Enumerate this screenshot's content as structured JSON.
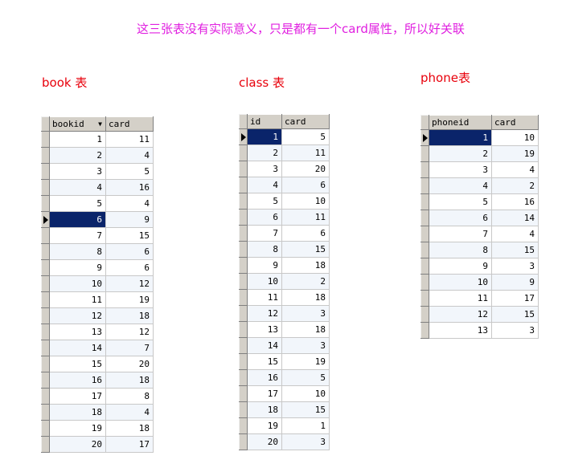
{
  "caption": "这三张表没有实际意义，只是都有一个card属性，所以好关联",
  "book": {
    "label": "book 表",
    "col1": "bookid",
    "col2": "card",
    "sort_icon": "sort-desc-icon",
    "selected_index": 5,
    "rows": [
      [
        "1",
        "11"
      ],
      [
        "2",
        "4"
      ],
      [
        "3",
        "5"
      ],
      [
        "4",
        "16"
      ],
      [
        "5",
        "4"
      ],
      [
        "6",
        "9"
      ],
      [
        "7",
        "15"
      ],
      [
        "8",
        "6"
      ],
      [
        "9",
        "6"
      ],
      [
        "10",
        "12"
      ],
      [
        "11",
        "19"
      ],
      [
        "12",
        "18"
      ],
      [
        "13",
        "12"
      ],
      [
        "14",
        "7"
      ],
      [
        "15",
        "20"
      ],
      [
        "16",
        "18"
      ],
      [
        "17",
        "8"
      ],
      [
        "18",
        "4"
      ],
      [
        "19",
        "18"
      ],
      [
        "20",
        "17"
      ]
    ]
  },
  "class": {
    "label": "class 表",
    "col1": "id",
    "col2": "card",
    "selected_index": 0,
    "rows": [
      [
        "1",
        "5"
      ],
      [
        "2",
        "11"
      ],
      [
        "3",
        "20"
      ],
      [
        "4",
        "6"
      ],
      [
        "5",
        "10"
      ],
      [
        "6",
        "11"
      ],
      [
        "7",
        "6"
      ],
      [
        "8",
        "15"
      ],
      [
        "9",
        "18"
      ],
      [
        "10",
        "2"
      ],
      [
        "11",
        "18"
      ],
      [
        "12",
        "3"
      ],
      [
        "13",
        "18"
      ],
      [
        "14",
        "3"
      ],
      [
        "15",
        "19"
      ],
      [
        "16",
        "5"
      ],
      [
        "17",
        "10"
      ],
      [
        "18",
        "15"
      ],
      [
        "19",
        "1"
      ],
      [
        "20",
        "3"
      ]
    ]
  },
  "phone": {
    "label": "phone表",
    "col1": "phoneid",
    "col2": "card",
    "selected_index": 0,
    "rows": [
      [
        "1",
        "10"
      ],
      [
        "2",
        "19"
      ],
      [
        "3",
        "4"
      ],
      [
        "4",
        "2"
      ],
      [
        "5",
        "16"
      ],
      [
        "6",
        "14"
      ],
      [
        "7",
        "4"
      ],
      [
        "8",
        "15"
      ],
      [
        "9",
        "3"
      ],
      [
        "10",
        "9"
      ],
      [
        "11",
        "17"
      ],
      [
        "12",
        "15"
      ],
      [
        "13",
        "3"
      ]
    ]
  },
  "colors": {
    "caption": "#e020e0",
    "label": "#e8000b",
    "selection": "#0a246a"
  }
}
